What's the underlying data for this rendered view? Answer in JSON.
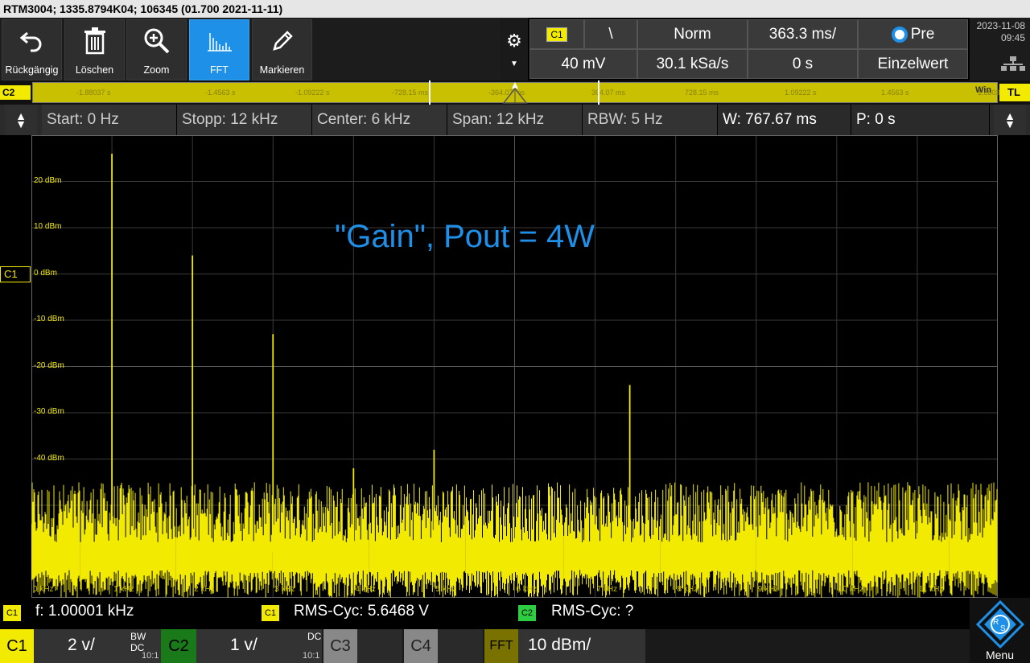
{
  "title": "RTM3004; 1335.8794K04; 106345 (01.700 2021-11-11)",
  "toolbar": {
    "undo_label": "Rückgängig",
    "delete_label": "Löschen",
    "zoom_label": "Zoom",
    "fft_label": "FFT",
    "mark_label": "Markieren"
  },
  "trigger": {
    "source": "C1",
    "slope_symbol": "\\",
    "mode": "Norm",
    "timebase": "363.3 ms/",
    "pre": "Pre",
    "level": "40 mV",
    "sample_rate": "30.1 kSa/s",
    "position": "0 s",
    "acquisition": "Einzelwert"
  },
  "datetime": {
    "date": "2023-11-08",
    "time": "09:45"
  },
  "strip": {
    "c2_tag": "C2",
    "tl_tag": "TL",
    "win_tag": "Win",
    "ticks": [
      "-1.88037 s",
      "-1.4563 s",
      "-1.09222 s",
      "-728.15 ms",
      "-364.07 ms",
      "364.07 ms",
      "728.15 ms",
      "1.09222 s",
      "1.4563 s",
      "1.88037 s"
    ]
  },
  "info": {
    "start": "Start: 0 Hz",
    "stop": "Stopp: 12 kHz",
    "center": "Center: 6 kHz",
    "span": "Span: 12 kHz",
    "rbw": "RBW: 5 Hz",
    "window": "W: 767.67 ms",
    "pos": "P: 0 s"
  },
  "plot": {
    "annotation": "\"Gain\", Pout = 4W",
    "c1_marker": "C1",
    "y_labels": [
      "20 dBm",
      "10 dBm",
      "0 dBm",
      "-10 dBm",
      "-20 dBm",
      "-30 dBm",
      "-40 dBm"
    ],
    "x_labels": [
      "0 kHz",
      "1 kHz",
      "2 kHz",
      "3 kHz",
      "4 kHz",
      "5 kHz",
      "6 kHz",
      "7 kHz",
      "8 kHz",
      "9 kHz",
      "10 kHz",
      "11 kHz"
    ]
  },
  "chart_data": {
    "type": "line",
    "xlabel": "",
    "ylabel": "",
    "x_range_khz": [
      0,
      12
    ],
    "y_range_dbm": [
      -70,
      30
    ],
    "grid": true,
    "series": [
      {
        "peaks_khz": [
          1,
          2,
          3,
          4,
          5,
          6.43,
          7.43,
          8.43
        ],
        "peaks_dbm": [
          26,
          4,
          -13,
          -42,
          -38,
          -46,
          -24,
          -47
        ]
      }
    ],
    "noise_floor_dbm": [
      -60,
      -47
    ]
  },
  "measurements": {
    "m1_badge": "C1",
    "m1_text": "f: 1.00001 kHz",
    "m2_badge": "C1",
    "m2_text": "RMS-Cyc: 5.6468 V",
    "m3_badge": "C2",
    "m3_text": "RMS-Cyc: ?"
  },
  "channels": {
    "c1_label": "C1",
    "c1_scale": "2 v/",
    "c1_bw": "BW DC",
    "c1_probe": "10:1",
    "c2_label": "C2",
    "c2_scale": "1 v/",
    "c2_coupling": "DC",
    "c2_probe": "10:1",
    "c3_label": "C3",
    "c4_label": "C4",
    "fft_label": "FFT",
    "fft_scale": "10 dBm/"
  },
  "menu_label": "Menu",
  "colors": {
    "trace": "#f2ea00",
    "accent": "#1e90e8",
    "c2": "#2ecc40"
  }
}
